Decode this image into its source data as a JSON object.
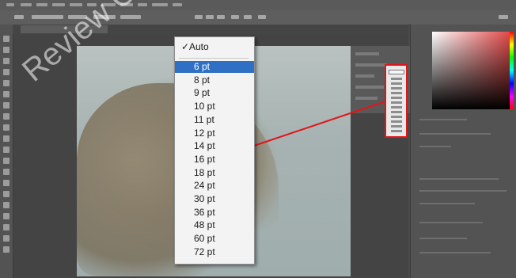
{
  "document": {
    "tab_title": "",
    "photo_label_lines": [
      "",
      ""
    ]
  },
  "font_size_menu": {
    "items": [
      {
        "label": "Auto",
        "checked": true,
        "highlighted": false
      },
      {
        "label": "6 pt",
        "checked": false,
        "highlighted": true
      },
      {
        "label": "8 pt",
        "checked": false,
        "highlighted": false
      },
      {
        "label": "9 pt",
        "checked": false,
        "highlighted": false
      },
      {
        "label": "10 pt",
        "checked": false,
        "highlighted": false
      },
      {
        "label": "11 pt",
        "checked": false,
        "highlighted": false
      },
      {
        "label": "12 pt",
        "checked": false,
        "highlighted": false
      },
      {
        "label": "14 pt",
        "checked": false,
        "highlighted": false
      },
      {
        "label": "16 pt",
        "checked": false,
        "highlighted": false
      },
      {
        "label": "18 pt",
        "checked": false,
        "highlighted": false
      },
      {
        "label": "24 pt",
        "checked": false,
        "highlighted": false
      },
      {
        "label": "30 pt",
        "checked": false,
        "highlighted": false
      },
      {
        "label": "36 pt",
        "checked": false,
        "highlighted": false
      },
      {
        "label": "48 pt",
        "checked": false,
        "highlighted": false
      },
      {
        "label": "60 pt",
        "checked": false,
        "highlighted": false
      },
      {
        "label": "72 pt",
        "checked": false,
        "highlighted": false
      }
    ],
    "checkmark": "✓"
  },
  "watermark": "Review C",
  "colors": {
    "highlight": "#2f6fc4",
    "callout": "#e1161a"
  }
}
